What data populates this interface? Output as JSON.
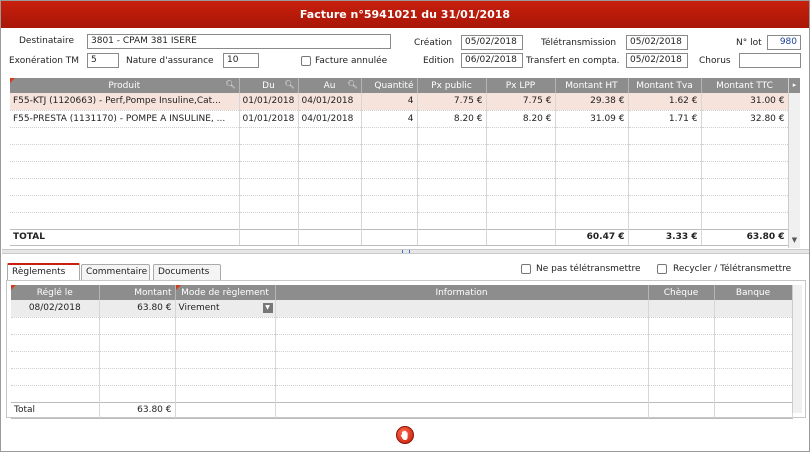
{
  "window": {
    "title": "Facture n°5941021 du 31/01/2018"
  },
  "header": {
    "destinataire_label": "Destinataire",
    "destinataire_value": "3801 - CPAM 381 ISERE",
    "exoneration_label": "Exonération TM",
    "exoneration_value": "5",
    "nature_label": "Nature d'assurance",
    "nature_value": "10",
    "annulee_label": "Facture annulée",
    "creation_label": "Création",
    "creation_value": "05/02/2018",
    "edition_label": "Edition",
    "edition_value": "06/02/2018",
    "teletrans_label": "Télétransmission",
    "teletrans_value": "05/02/2018",
    "transfert_label": "Transfert en compta.",
    "transfert_value": "05/02/2018",
    "lot_label": "N° lot",
    "lot_value": "980",
    "chorus_label": "Chorus",
    "chorus_value": ""
  },
  "products": {
    "columns": [
      "Produit",
      "Du",
      "Au",
      "Quantité",
      "Px public",
      "Px LPP",
      "Montant HT",
      "Montant Tva",
      "Montant TTC"
    ],
    "rows": [
      [
        "F55-KTJ (1120663) - Perf,Pompe Insuline,Cat...",
        "01/01/2018",
        "04/01/2018",
        "4",
        "7.75 €",
        "7.75 €",
        "29.38 €",
        "1.62 €",
        "31.00 €"
      ],
      [
        "F55-PRESTA (1131170) - POMPE A INSULINE, ...",
        "01/01/2018",
        "04/01/2018",
        "4",
        "8.20 €",
        "8.20 €",
        "31.09 €",
        "1.71 €",
        "32.80 €"
      ]
    ],
    "total_label": "TOTAL",
    "total_ht": "60.47 €",
    "total_tva": "3.33 €",
    "total_ttc": "63.80 €"
  },
  "tabs": [
    {
      "label": "Règlements",
      "active": true
    },
    {
      "label": "Commentaire",
      "active": false
    },
    {
      "label": "Documents",
      "active": false
    }
  ],
  "options": {
    "ne_pas_label": "Ne pas télétransmettre",
    "recycler_label": "Recycler / Télétransmettre"
  },
  "reglements": {
    "columns": [
      "Réglé le",
      "Montant",
      "Mode de règlement",
      "Information",
      "Chèque",
      "Banque"
    ],
    "rows": [
      [
        "08/02/2018",
        "63.80 €",
        "Virement",
        "",
        "",
        ""
      ]
    ],
    "total_label": "Total",
    "total_value": "63.80 €"
  },
  "colors": {
    "accent": "#c8200d",
    "header_gray": "#8d8d8d",
    "selected_row": "#f6e3dc"
  }
}
